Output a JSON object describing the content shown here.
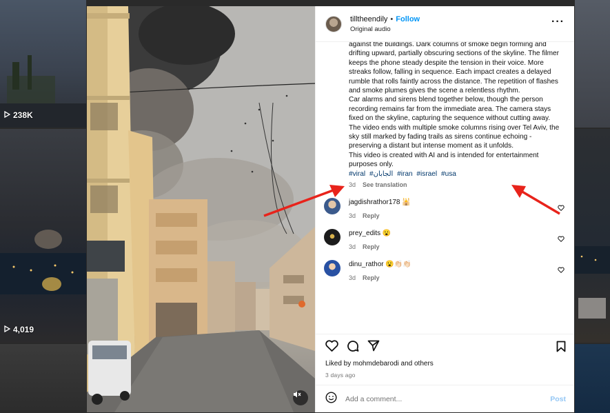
{
  "background": {
    "stats": [
      {
        "icon": "play-icon",
        "count": "238K"
      },
      {
        "icon": "play-icon",
        "count": "4,019"
      }
    ]
  },
  "post": {
    "username": "tilltheendily",
    "follow_label": "Follow",
    "audio": "Original audio",
    "more_icon": "more-options-icon",
    "caption_lines": [
      "against the buildings. Dark columns of smoke begin forming and drifting upward, partially obscuring sections of the skyline. The filmer keeps the phone steady despite the tension in their voice. More streaks follow, falling in sequence. Each impact creates a delayed rumble that rolls faintly across the distance. The repetition of flashes and smoke plumes gives the scene a relentless rhythm.",
      "Car alarms and sirens blend together below, though the person recording remains far from the immediate area. The camera stays fixed on the skyline, capturing the sequence without cutting away.",
      "The video ends with multiple smoke columns rising over Tel Aviv, the sky still marked by fading trails as sirens continue echoing - preserving a distant but intense moment as it unfolds.",
      "This video is created with AI and is intended for entertainment purposes only."
    ],
    "hashtags": [
      "#viral",
      "#الجابان",
      "#iran",
      "#israel",
      "#usa"
    ],
    "caption_age": "3d",
    "see_translation": "See translation"
  },
  "comments": [
    {
      "user": "jagdishrathor178 🕌",
      "age": "3d",
      "reply": "Reply"
    },
    {
      "user": "prey_edits 😮",
      "age": "3d",
      "reply": "Reply"
    },
    {
      "user": "dinu_rathor 😮👏🏻👏🏻",
      "age": "3d",
      "reply": "Reply"
    }
  ],
  "footer": {
    "liked_by_prefix": "Liked by ",
    "liked_by_user": "mohmdebarodi",
    "liked_by_suffix": " and others",
    "date": "3 days ago",
    "comment_placeholder": "Add a comment...",
    "post_label": "Post"
  },
  "colors": {
    "accent": "#0095f6",
    "hashtag": "#00376b",
    "annotation_arrows": "#e8231b"
  }
}
